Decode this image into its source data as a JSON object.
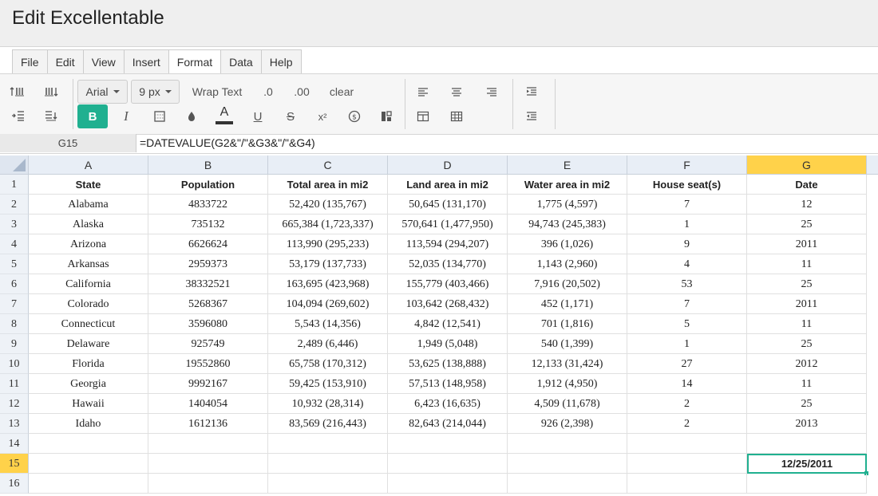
{
  "app": {
    "title": "Edit Excellentable"
  },
  "menu": {
    "items": [
      {
        "label": "File"
      },
      {
        "label": "Edit"
      },
      {
        "label": "View"
      },
      {
        "label": "Insert"
      },
      {
        "label": "Format"
      },
      {
        "label": "Data"
      },
      {
        "label": "Help"
      }
    ],
    "active": "Format"
  },
  "toolbar": {
    "font_family": "Arial",
    "font_size": "9 px",
    "wrap_text": "Wrap Text",
    "decrease_decimal": ".0",
    "increase_decimal": ".00",
    "clear": "clear",
    "bold": "B",
    "italic": "I",
    "font_color": "A",
    "underline": "U",
    "strikethrough": "S",
    "superscript": "x²"
  },
  "formula_bar": {
    "cell_ref": "G15",
    "formula": "=DATEVALUE(G2&\"/\"&G3&\"/\"&G4)"
  },
  "grid": {
    "columns": [
      "A",
      "B",
      "C",
      "D",
      "E",
      "F",
      "G"
    ],
    "selected_column": "G",
    "selected_row": "15",
    "header_row": [
      "State",
      "Population",
      "Total area in mi2",
      "Land area in mi2",
      "Water area in mi2",
      "House seat(s)",
      "Date"
    ],
    "rows": [
      [
        "Alabama",
        "4833722",
        "52,420 (135,767)",
        "50,645 (131,170)",
        "1,775 (4,597)",
        "7",
        "12"
      ],
      [
        "Alaska",
        "735132",
        "665,384 (1,723,337)",
        "570,641 (1,477,950)",
        "94,743 (245,383)",
        "1",
        "25"
      ],
      [
        "Arizona",
        "6626624",
        "113,990 (295,233)",
        "113,594 (294,207)",
        "396 (1,026)",
        "9",
        "2011"
      ],
      [
        "Arkansas",
        "2959373",
        "53,179 (137,733)",
        "52,035 (134,770)",
        "1,143 (2,960)",
        "4",
        "11"
      ],
      [
        "California",
        "38332521",
        "163,695 (423,968)",
        "155,779 (403,466)",
        "7,916 (20,502)",
        "53",
        "25"
      ],
      [
        "Colorado",
        "5268367",
        "104,094 (269,602)",
        "103,642 (268,432)",
        "452 (1,171)",
        "7",
        "2011"
      ],
      [
        "Connecticut",
        "3596080",
        "5,543 (14,356)",
        "4,842 (12,541)",
        "701 (1,816)",
        "5",
        "11"
      ],
      [
        "Delaware",
        "925749",
        "2,489 (6,446)",
        "1,949 (5,048)",
        "540 (1,399)",
        "1",
        "25"
      ],
      [
        "Florida",
        "19552860",
        "65,758 (170,312)",
        "53,625 (138,888)",
        "12,133 (31,424)",
        "27",
        "2012"
      ],
      [
        "Georgia",
        "9992167",
        "59,425 (153,910)",
        "57,513 (148,958)",
        "1,912 (4,950)",
        "14",
        "11"
      ],
      [
        "Hawaii",
        "1404054",
        "10,932 (28,314)",
        "6,423 (16,635)",
        "4,509 (11,678)",
        "2",
        "25"
      ],
      [
        "Idaho",
        "1612136",
        "83,569 (216,443)",
        "82,643 (214,044)",
        "926 (2,398)",
        "2",
        "2013"
      ]
    ],
    "row_numbers": [
      "1",
      "2",
      "3",
      "4",
      "5",
      "6",
      "7",
      "8",
      "9",
      "10",
      "11",
      "12",
      "13",
      "14",
      "15",
      "16"
    ],
    "selected_cell_value": "12/25/2011"
  },
  "colors": {
    "accent": "#20b090",
    "selection_header": "#ffd24a"
  }
}
